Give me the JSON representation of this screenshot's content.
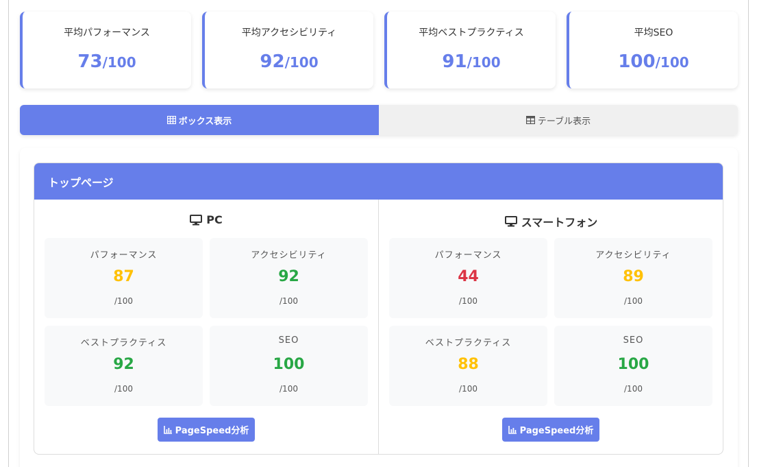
{
  "colors": {
    "accent": "#667eea",
    "good": "#28a745",
    "average": "#ffc107",
    "poor": "#dc3545"
  },
  "summary": [
    {
      "label": "平均パフォーマンス",
      "value": "73",
      "max": "/100"
    },
    {
      "label": "平均アクセシビリティ",
      "value": "92",
      "max": "/100"
    },
    {
      "label": "平均ベストプラクティス",
      "value": "91",
      "max": "/100"
    },
    {
      "label": "平均SEO",
      "value": "100",
      "max": "/100"
    }
  ],
  "view_toggle": {
    "box_label": "ボックス表示",
    "table_label": "テーブル表示",
    "active": "box",
    "box_icon": "grid-icon",
    "table_icon": "table-icon"
  },
  "page": {
    "title": "トップページ",
    "devices": [
      {
        "name": "PC",
        "icon": "monitor-icon",
        "metrics": [
          {
            "label": "パフォーマンス",
            "value": "87",
            "max": "/100",
            "status": "average"
          },
          {
            "label": "アクセシビリティ",
            "value": "92",
            "max": "/100",
            "status": "good"
          },
          {
            "label": "ベストプラクティス",
            "value": "92",
            "max": "/100",
            "status": "good"
          },
          {
            "label": "SEO",
            "value": "100",
            "max": "/100",
            "status": "good"
          }
        ],
        "button_label": "PageSpeed分析",
        "button_icon": "chart-icon"
      },
      {
        "name": "スマートフォン",
        "icon": "monitor-icon",
        "metrics": [
          {
            "label": "パフォーマンス",
            "value": "44",
            "max": "/100",
            "status": "poor"
          },
          {
            "label": "アクセシビリティ",
            "value": "89",
            "max": "/100",
            "status": "average"
          },
          {
            "label": "ベストプラクティス",
            "value": "88",
            "max": "/100",
            "status": "average"
          },
          {
            "label": "SEO",
            "value": "100",
            "max": "/100",
            "status": "good"
          }
        ],
        "button_label": "PageSpeed分析",
        "button_icon": "chart-icon"
      }
    ]
  }
}
